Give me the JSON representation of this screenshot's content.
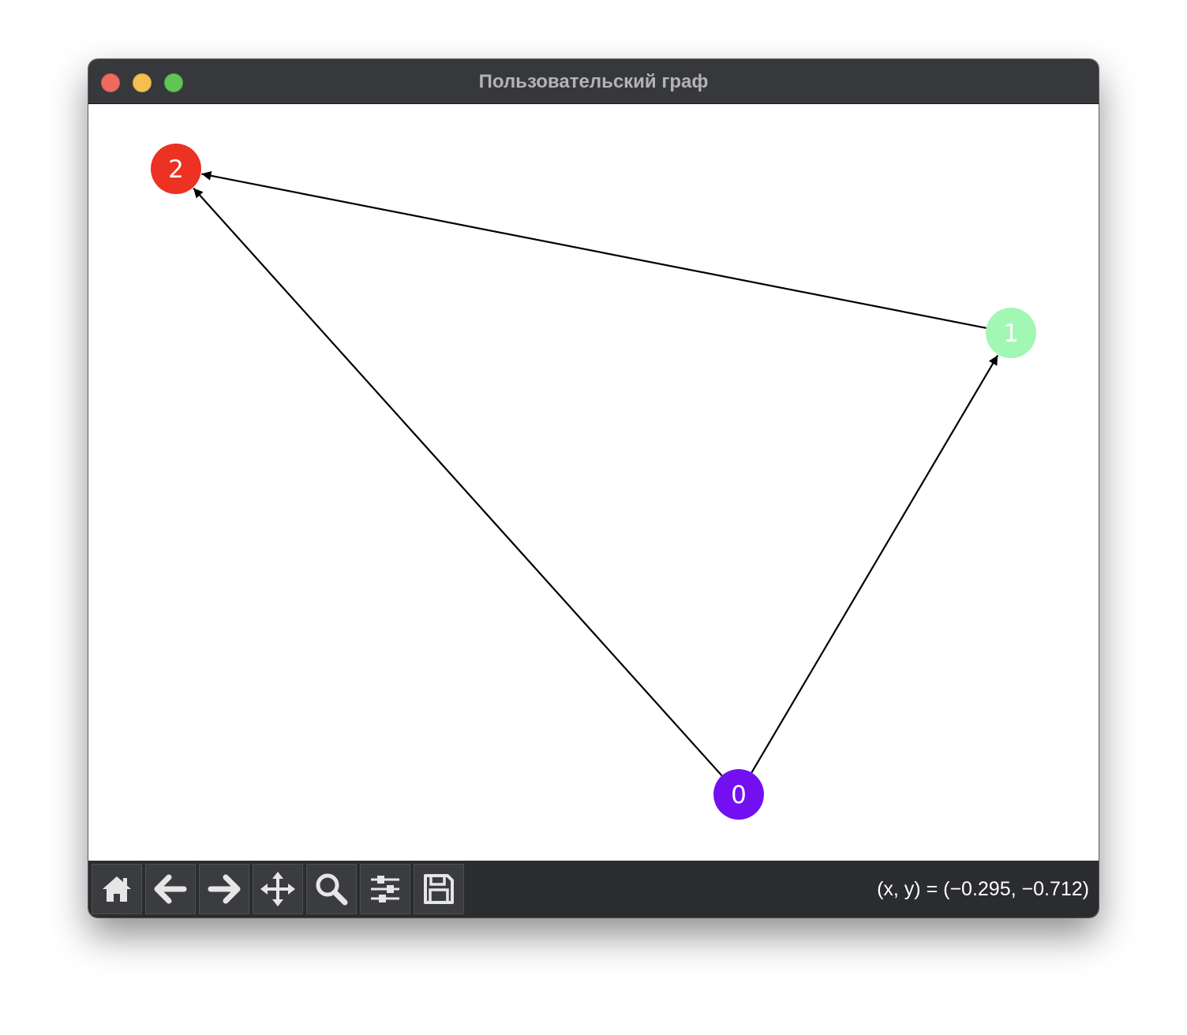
{
  "window": {
    "title": "Пользовательский граф",
    "traffic_lights": {
      "close_color": "#ed6a5e",
      "minimize_color": "#f4bf4f",
      "maximize_color": "#61c554"
    }
  },
  "graph": {
    "nodes": [
      {
        "id": "0",
        "label": "0",
        "color": "#7210f2"
      },
      {
        "id": "1",
        "label": "1",
        "color": "#a3f7b5"
      },
      {
        "id": "2",
        "label": "2",
        "color": "#eb3223"
      }
    ],
    "edges": [
      {
        "from": "0",
        "to": "1",
        "directed": true
      },
      {
        "from": "0",
        "to": "2",
        "directed": true
      },
      {
        "from": "1",
        "to": "2",
        "directed": true
      }
    ]
  },
  "toolbar": {
    "buttons": [
      {
        "name": "home",
        "icon": "home-icon"
      },
      {
        "name": "back",
        "icon": "arrow-left-icon"
      },
      {
        "name": "forward",
        "icon": "arrow-right-icon"
      },
      {
        "name": "pan",
        "icon": "move-icon"
      },
      {
        "name": "zoom",
        "icon": "magnifier-icon"
      },
      {
        "name": "configure-subplots",
        "icon": "sliders-icon"
      },
      {
        "name": "save",
        "icon": "floppy-disk-icon"
      }
    ],
    "coordinates_text": "(x, y) = (−0.295, −0.712)"
  }
}
